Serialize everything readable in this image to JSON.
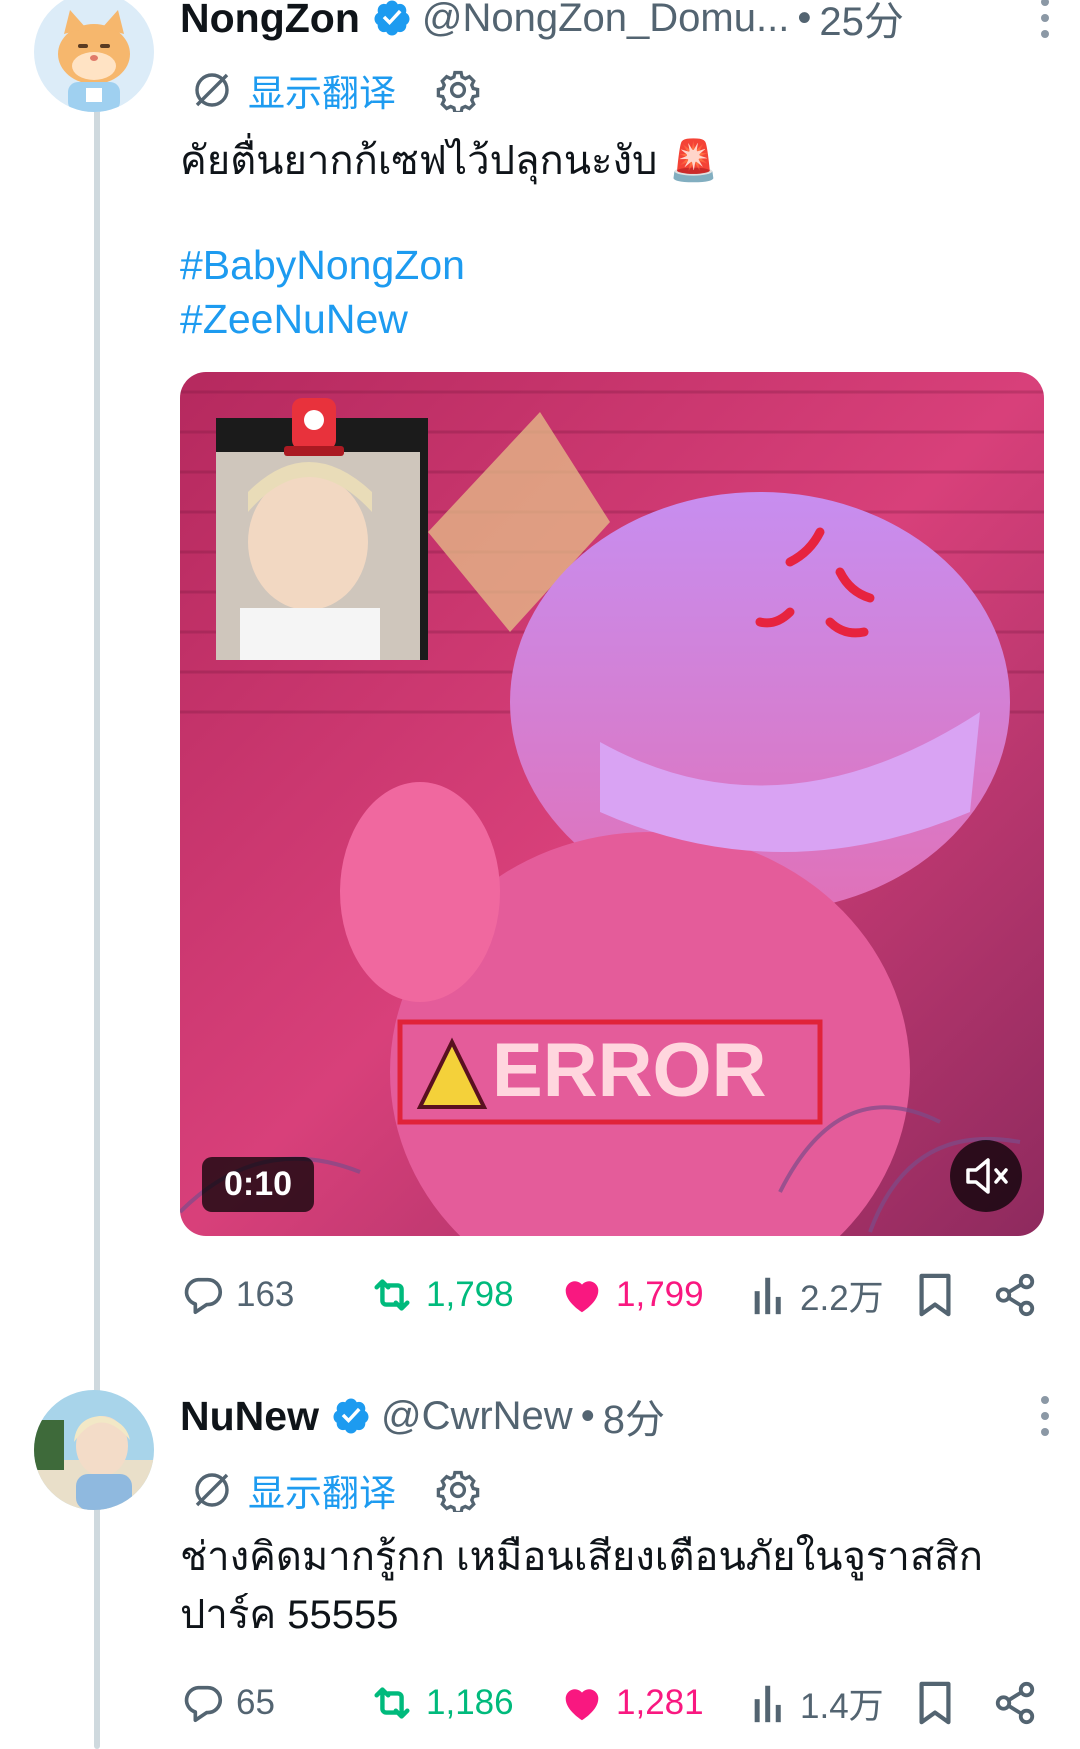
{
  "colors": {
    "link": "#1d9bf0",
    "verified": "#1d9bf0",
    "retweeted": "#00ba7c",
    "liked": "#f91880",
    "secondary_text": "#536471"
  },
  "tweets": [
    {
      "display_name": "NongZon",
      "handle": "@NongZon_Domu...",
      "separator": "•",
      "time": "25分",
      "translate_label": "显示翻译",
      "text": "คัยตื่นยากก้เซฟไว้ปลุกนะงับ 🚨",
      "hashtags": [
        "#BabyNongZon",
        "#ZeeNuNew"
      ],
      "media": {
        "duration": "0:10",
        "overlay_text": "ERROR",
        "mute_icon": "speaker-muted-icon"
      },
      "stats": {
        "replies": "163",
        "retweets": "1,798",
        "likes": "1,799",
        "views": "2.2万"
      }
    },
    {
      "display_name": "NuNew",
      "handle": "@CwrNew",
      "separator": "•",
      "time": "8分",
      "translate_label": "显示翻译",
      "text": "ช่างคิดมากรู้กก เหมือนเสียงเตือนภัยในจูราสสิกปาร์ค 55555",
      "stats": {
        "replies": "65",
        "retweets": "1,186",
        "likes": "1,281",
        "views": "1.4万"
      }
    }
  ]
}
